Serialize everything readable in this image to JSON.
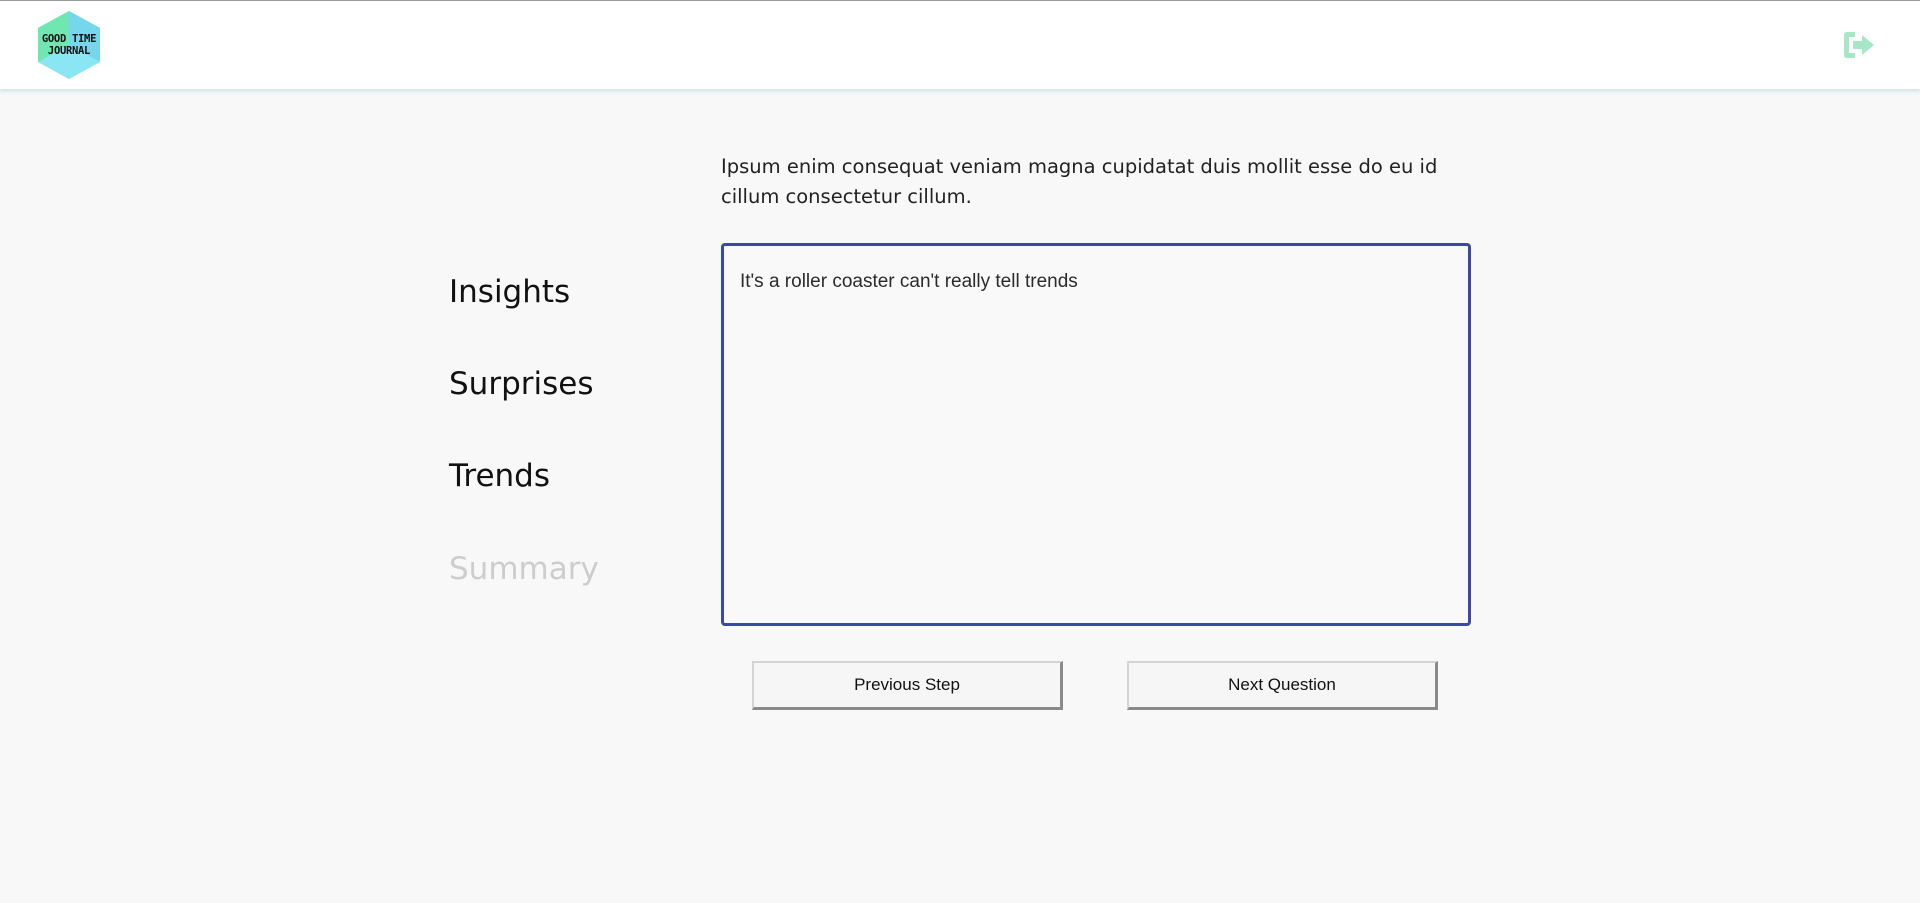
{
  "header": {
    "logo": {
      "line1": "GOOD TIME",
      "line2": "JOURNAL",
      "colors": [
        "#6fe3b0",
        "#74d8f0",
        "#8ae8f2"
      ]
    },
    "logout_icon": "sign-out-icon",
    "logout_color": "#a6e8c6"
  },
  "steps": {
    "items": [
      {
        "label": "Insights",
        "state": "completed"
      },
      {
        "label": "Surprises",
        "state": "completed"
      },
      {
        "label": "Trends",
        "state": "current"
      },
      {
        "label": "Summary",
        "state": "upcoming"
      }
    ]
  },
  "question": {
    "prompt": "Ipsum enim consequat veniam magna cupidatat duis mollit esse do eu id cillum consectetur cillum.",
    "answer_value": "It's a roller coaster can't really tell trends"
  },
  "buttons": {
    "previous_label": "Previous Step",
    "next_label": "Next Question"
  },
  "colors": {
    "textarea_border": "#3a49a6",
    "inactive_step": "#cdcdcd"
  }
}
